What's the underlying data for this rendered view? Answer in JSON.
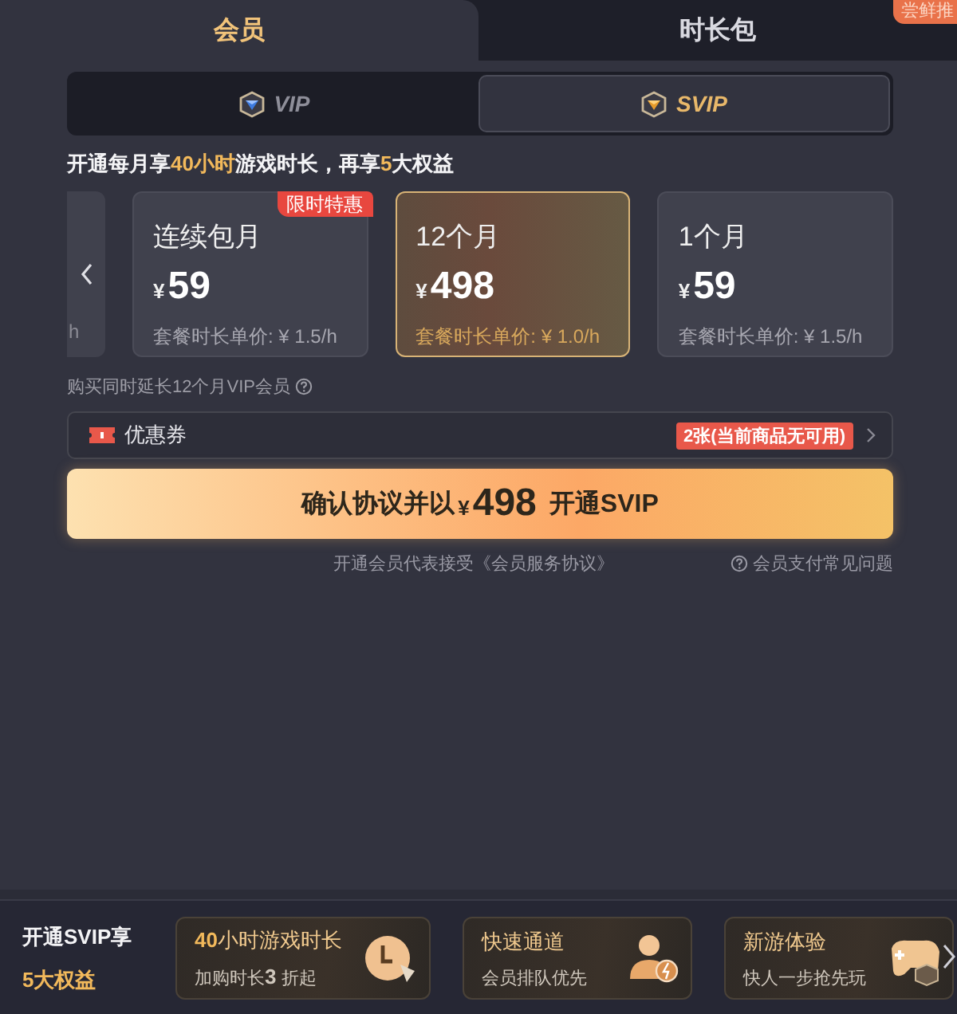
{
  "tabs": [
    {
      "label": "会员",
      "selected": true
    },
    {
      "label": "时长包",
      "selected": false,
      "badge": "尝鲜推"
    }
  ],
  "tiers": [
    {
      "label": "VIP",
      "kind": "vip",
      "selected": false
    },
    {
      "label": "SVIP",
      "kind": "svip",
      "selected": true
    }
  ],
  "headline": "开通每月享**40小时**游戏时长，再享**5**大权益",
  "plans": [
    {
      "kind": "partial",
      "unit_price": "h"
    },
    {
      "kind": "plan",
      "name": "连续包月",
      "currency": "¥",
      "price": "59",
      "unit_price": "套餐时长单价: ¥ 1.5/h",
      "badge": "限时特惠",
      "selected": false
    },
    {
      "kind": "plan",
      "name": "12个月",
      "currency": "¥",
      "price": "498",
      "unit_price": "套餐时长单价: ¥ 1.0/h",
      "selected": true
    },
    {
      "kind": "plan",
      "name": "1个月",
      "currency": "¥",
      "price": "59",
      "unit_price": "套餐时长单价: ¥ 1.5/h",
      "selected": false
    }
  ],
  "note": "购买同时延长12个月VIP会员",
  "coupon": {
    "label": "优惠券",
    "status": "2张(当前商品无可用)"
  },
  "confirm": {
    "before": "确认协议并以",
    "currency": "¥",
    "price": "498",
    "after": "开通SVIP"
  },
  "agreement": "开通会员代表接受《会员服务协议》",
  "faq": "会员支付常见问题",
  "benefits": {
    "title": "开通SVIP享",
    "subtitle": "5大权益",
    "items": [
      {
        "kind": "clock",
        "title": "**40**小时游戏时长",
        "text": "加购时长**3** 折起"
      },
      {
        "kind": "user",
        "title": "快速通道",
        "text": "会员排队优先"
      },
      {
        "kind": "gamepad",
        "title": "新游体验",
        "text": "快人一步抢先玩"
      }
    ]
  }
}
